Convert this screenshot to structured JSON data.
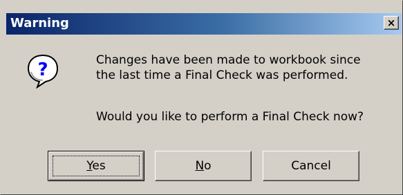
{
  "window": {
    "title": "Warning",
    "close_glyph": "×"
  },
  "dialog": {
    "icon": "question-icon",
    "message_line_1": "Changes have been made to workbook since",
    "message_line_2": "the last time a Final Check was performed.",
    "question": "Would you like to perform a Final Check now?"
  },
  "buttons": {
    "yes": {
      "mnemonic": "Y",
      "rest": "es"
    },
    "no": {
      "mnemonic": "N",
      "rest": "o"
    },
    "cancel": {
      "label": "Cancel"
    }
  },
  "colors": {
    "titlebar_start": "#0a246a",
    "titlebar_end": "#a6caf0",
    "face": "#d4d0c8",
    "icon_blue": "#0000ff"
  }
}
